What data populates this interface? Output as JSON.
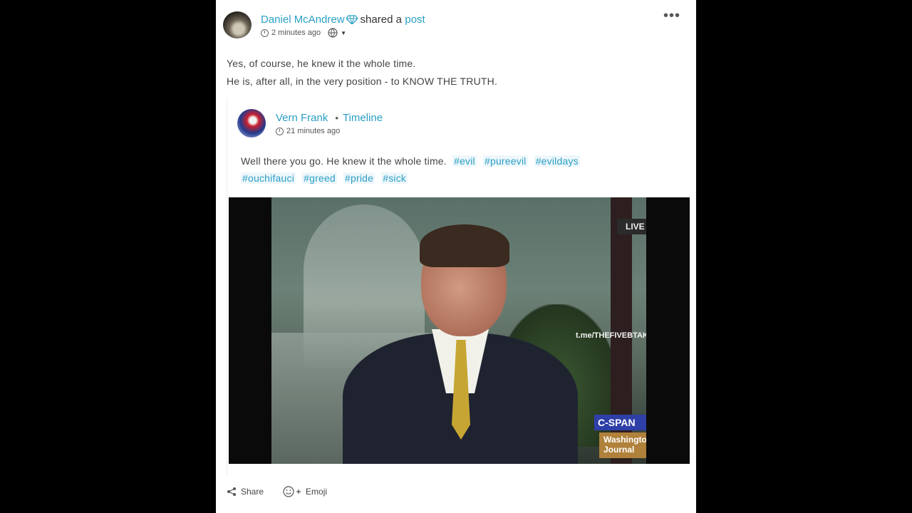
{
  "post": {
    "author": "Daniel McAndrew",
    "action_text": "shared a",
    "action_link": "post",
    "time": "2 minutes ago",
    "more": "•••",
    "text_lines": [
      "Yes, of course, he knew it the whole time.",
      "He is, after all, in the very position - to KNOW THE TRUTH."
    ]
  },
  "shared": {
    "author": "Vern Frank",
    "separator": "•",
    "location": "Timeline",
    "time": "21 minutes ago",
    "text": "Well there you go. He knew it the whole time.",
    "hashtags": [
      "#evil",
      "#pureevil",
      "#evildays",
      "#ouchifauci",
      "#greed",
      "#pride",
      "#sick"
    ]
  },
  "video": {
    "live_badge": "LIVE",
    "watermark": "t.me/THEFIVEBTAKE",
    "network": "C-SPAN",
    "program_line1": "Washingto",
    "program_line2": "Journal"
  },
  "actions": {
    "share": "Share",
    "emoji": "Emoji"
  },
  "colors": {
    "accent": "#2a9fc5",
    "background": "#000000",
    "card": "#ffffff"
  }
}
